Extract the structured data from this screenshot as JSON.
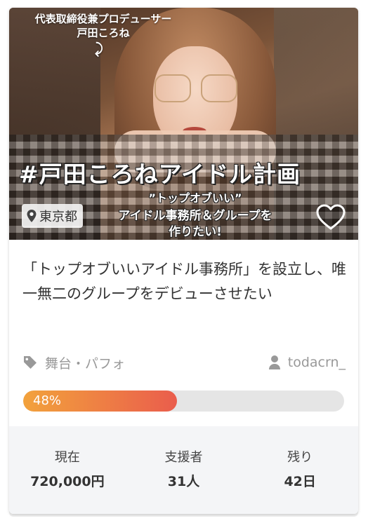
{
  "hero": {
    "caption_line1": "代表取締役兼プロデューサー",
    "caption_line2": "戸田ころね",
    "hashtag": "#戸田ころねアイドル計画",
    "sub1": "”トップオブいい”",
    "sub2": "アイドル事務所＆グループを",
    "sub3": "作りたい!",
    "location": "東京都",
    "location_icon": "map-pin-icon",
    "favorite_icon": "heart-outline-icon"
  },
  "project": {
    "title": "「トップオブいいアイドル事務所」を設立し、唯一無二のグループをデビューさせたい",
    "category": "舞台・パフォ",
    "category_icon": "tag-icon",
    "owner": "todacrn_",
    "owner_icon": "user-icon",
    "progress_label": "48%",
    "progress": 0.48
  },
  "stats": [
    {
      "label": "現在",
      "value": "720,000円"
    },
    {
      "label": "支援者",
      "value": "31人"
    },
    {
      "label": "残り",
      "value": "42日"
    }
  ],
  "colors": {
    "progress_start": "#f2a23c",
    "progress_end": "#ea5d4c",
    "track": "#e5e5e5",
    "meta_gray": "#999999"
  }
}
